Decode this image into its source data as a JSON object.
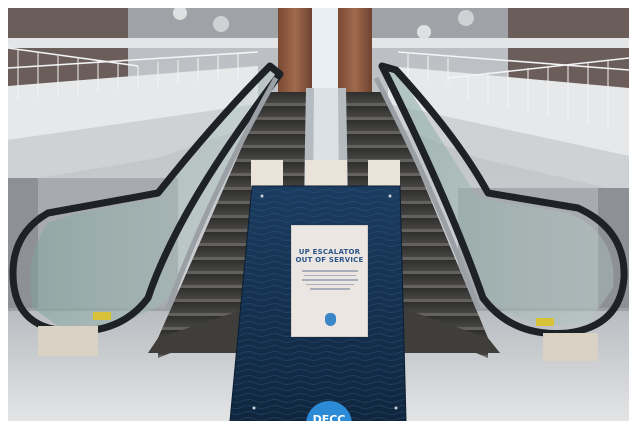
{
  "photo": {
    "subject": "",
    "sign": {
      "heading_line1": "UP ESCALATOR",
      "heading_line2": "OUT OF SERVICE",
      "logo_text": "DECC"
    }
  },
  "colors": {
    "sign_board": "#1c3e63",
    "sign_card": "#ece6e3",
    "badge": "#2b8bd6",
    "handrail": "#1e2125",
    "steps": "#3b3b3a"
  }
}
